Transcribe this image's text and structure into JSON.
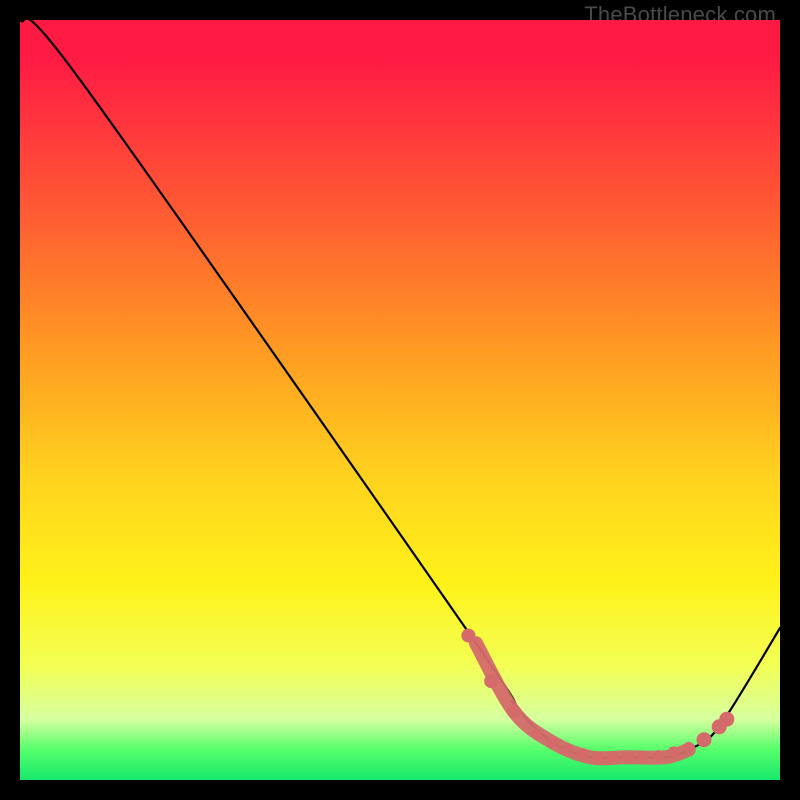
{
  "watermark": {
    "text": "TheBottleneck.com"
  },
  "chart_data": {
    "type": "line",
    "title": "",
    "xlabel": "",
    "ylabel": "",
    "xlim": [
      0,
      100
    ],
    "ylim": [
      0,
      100
    ],
    "grid": false,
    "series": [
      {
        "name": "curve",
        "x": [
          0,
          8,
          60,
          65,
          70,
          75,
          80,
          85,
          88,
          92,
          100
        ],
        "y": [
          100,
          92,
          18,
          10,
          5,
          3,
          3,
          3,
          4,
          7,
          20
        ]
      }
    ],
    "markers": {
      "name": "highlight-points",
      "color": "#d46a6a",
      "x": [
        59,
        62,
        65,
        68,
        70,
        72,
        74,
        76,
        78,
        80,
        82,
        84,
        86,
        88,
        90,
        92,
        93
      ],
      "y": [
        19,
        13,
        9,
        6,
        5,
        4,
        3.5,
        3,
        3,
        3,
        3,
        3.2,
        3.7,
        4.3,
        5.3,
        7,
        8
      ]
    }
  }
}
